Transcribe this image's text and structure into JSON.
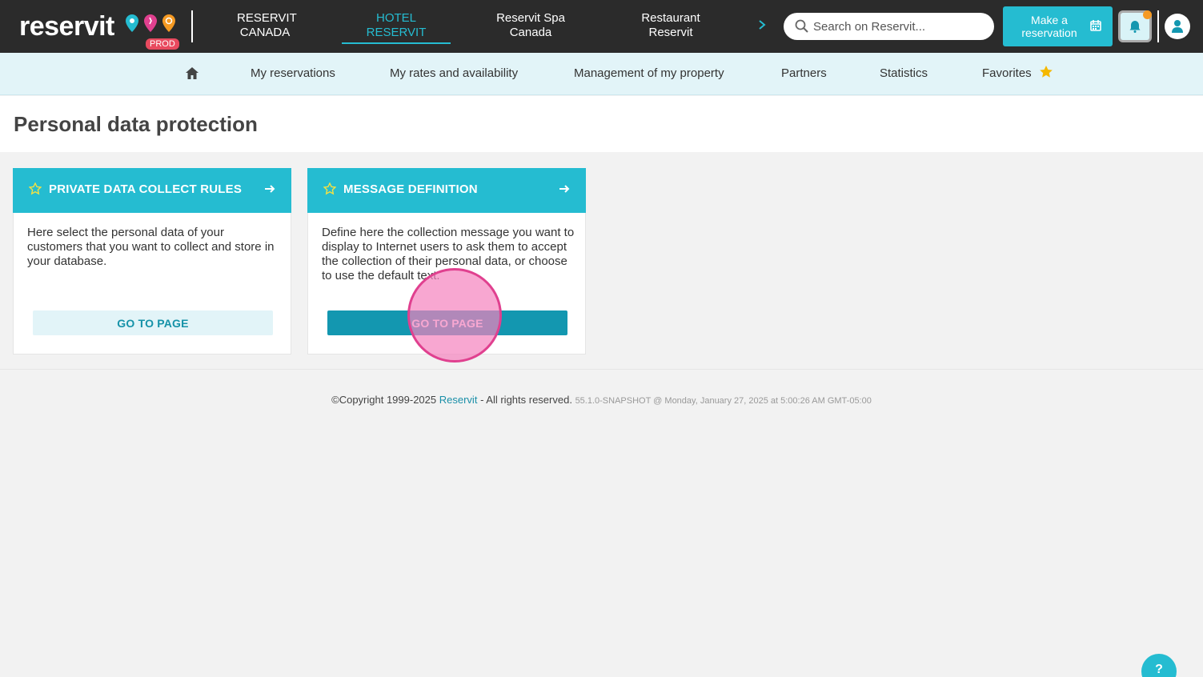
{
  "brand": {
    "logo_text": "reservit",
    "env_badge": "PROD",
    "pin_colors": [
      "#25bcd1",
      "#e0408f",
      "#f59a23"
    ]
  },
  "topnav": {
    "items": [
      {
        "label_line1": "RESERVIT",
        "label_line2": "CANADA",
        "active": false
      },
      {
        "label_line1": "HOTEL",
        "label_line2": "RESERVIT",
        "active": true
      },
      {
        "label_line1": "Reservit Spa",
        "label_line2": "Canada",
        "active": false
      },
      {
        "label_line1": "Restaurant",
        "label_line2": "Reservit",
        "active": false
      }
    ],
    "more_icon": "chevron-right-icon"
  },
  "search": {
    "placeholder": "Search on Reservit..."
  },
  "make_reservation": {
    "label_line1": "Make a",
    "label_line2": "reservation"
  },
  "subnav": {
    "items": [
      {
        "label": "My reservations"
      },
      {
        "label": "My rates and availability"
      },
      {
        "label": "Management of my property"
      },
      {
        "label": "Partners"
      },
      {
        "label": "Statistics"
      },
      {
        "label": "Favorites"
      }
    ]
  },
  "page": {
    "title": "Personal data protection"
  },
  "cards": [
    {
      "title": "PRIVATE DATA COLLECT RULES",
      "description": "Here select the personal data of your customers that you want to collect and store in your database.",
      "button": "GO TO PAGE"
    },
    {
      "title": "MESSAGE DEFINITION",
      "description": "Define here the collection message you want to display to Internet users to ask them to accept the collection of their personal data, or choose to use the default text.",
      "button": "GO TO PAGE"
    }
  ],
  "footer": {
    "copyright": "©Copyright 1999-2025",
    "brand": "Reservit",
    "rights": "- All rights reserved.",
    "version": "55.1.0-SNAPSHOT @ Monday, January 27, 2025 at 5:00:26 AM GMT-05:00"
  },
  "help": {
    "label": "?"
  },
  "colors": {
    "accent": "#25bcd1",
    "accent_dark": "#1397b0",
    "topbar": "#2b2b2b",
    "subnav_bg": "#e2f4f8",
    "favorite_star": "#f5b800"
  }
}
